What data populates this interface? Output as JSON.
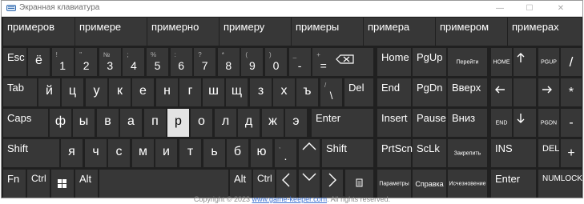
{
  "window": {
    "title": "Экранная клавиатура",
    "minimize": "—",
    "maximize": "☐",
    "close": "✕"
  },
  "predictions": [
    "примеров",
    "примере",
    "примерно",
    "примеру",
    "примеры",
    "примера",
    "примером",
    "примерах"
  ],
  "number_row": [
    {
      "shift": "",
      "main": "ё"
    },
    {
      "shift": "!",
      "main": "1"
    },
    {
      "shift": "\"",
      "main": "2"
    },
    {
      "shift": "№",
      "main": "3"
    },
    {
      "shift": ";",
      "main": "4"
    },
    {
      "shift": "%",
      "main": "5"
    },
    {
      "shift": ":",
      "main": "6"
    },
    {
      "shift": "?",
      "main": "7"
    },
    {
      "shift": "*",
      "main": "8"
    },
    {
      "shift": "(",
      "main": "9"
    },
    {
      "shift": ")",
      "main": "0"
    },
    {
      "shift": "_",
      "main": "-"
    },
    {
      "shift": "+",
      "main": "="
    }
  ],
  "keys": {
    "esc": "Esc",
    "tab": "Tab",
    "caps": "Caps",
    "shift_l": "Shift",
    "shift_r": "Shift",
    "fn": "Fn",
    "ctrl_l": "Ctrl",
    "alt_l": "Alt",
    "alt_r": "Alt",
    "ctrl_r": "Ctrl",
    "del": "Del",
    "enter": "Enter",
    "backslash_shift": "/",
    "backslash_main": "\\",
    "comma_shift": ",",
    "comma_main": ".",
    "home": "Home",
    "pgup": "PgUp",
    "nav_up_label": "Перейти",
    "end": "End",
    "pgdn": "PgDn",
    "vverh": "Вверх",
    "insert": "Insert",
    "pause": "Pause",
    "vniz": "Вниз",
    "prtscn": "PrtScn",
    "sclk": "ScLk",
    "zakrepit": "Закрепить",
    "parametry": "Параметры",
    "spravka": "Справка",
    "ischeznovenie": "Исчезновение",
    "np_home": "HOME",
    "np_pgup": "PGUP",
    "np_slash": "/",
    "np_star": "*",
    "np_end": "END",
    "np_pgdn": "PGDN",
    "np_minus": "-",
    "np_ins": "INS",
    "np_del": "DEL",
    "np_plus": "+",
    "np_enter": "Enter",
    "np_numlock": "NUMLOCK"
  },
  "row_q": [
    "й",
    "ц",
    "у",
    "к",
    "е",
    "н",
    "г",
    "ш",
    "щ",
    "з",
    "х",
    "ъ"
  ],
  "row_a": [
    "ф",
    "ы",
    "в",
    "а",
    "п",
    "р",
    "о",
    "л",
    "д",
    "ж",
    "э"
  ],
  "row_z": [
    "я",
    "ч",
    "с",
    "м",
    "и",
    "т",
    "ь",
    "б",
    "ю"
  ],
  "highlighted_key": "р",
  "footer": {
    "prefix": "Copyright © 2023 ",
    "link": "www.game-keeper.com",
    "suffix": ". All rights reserved."
  }
}
